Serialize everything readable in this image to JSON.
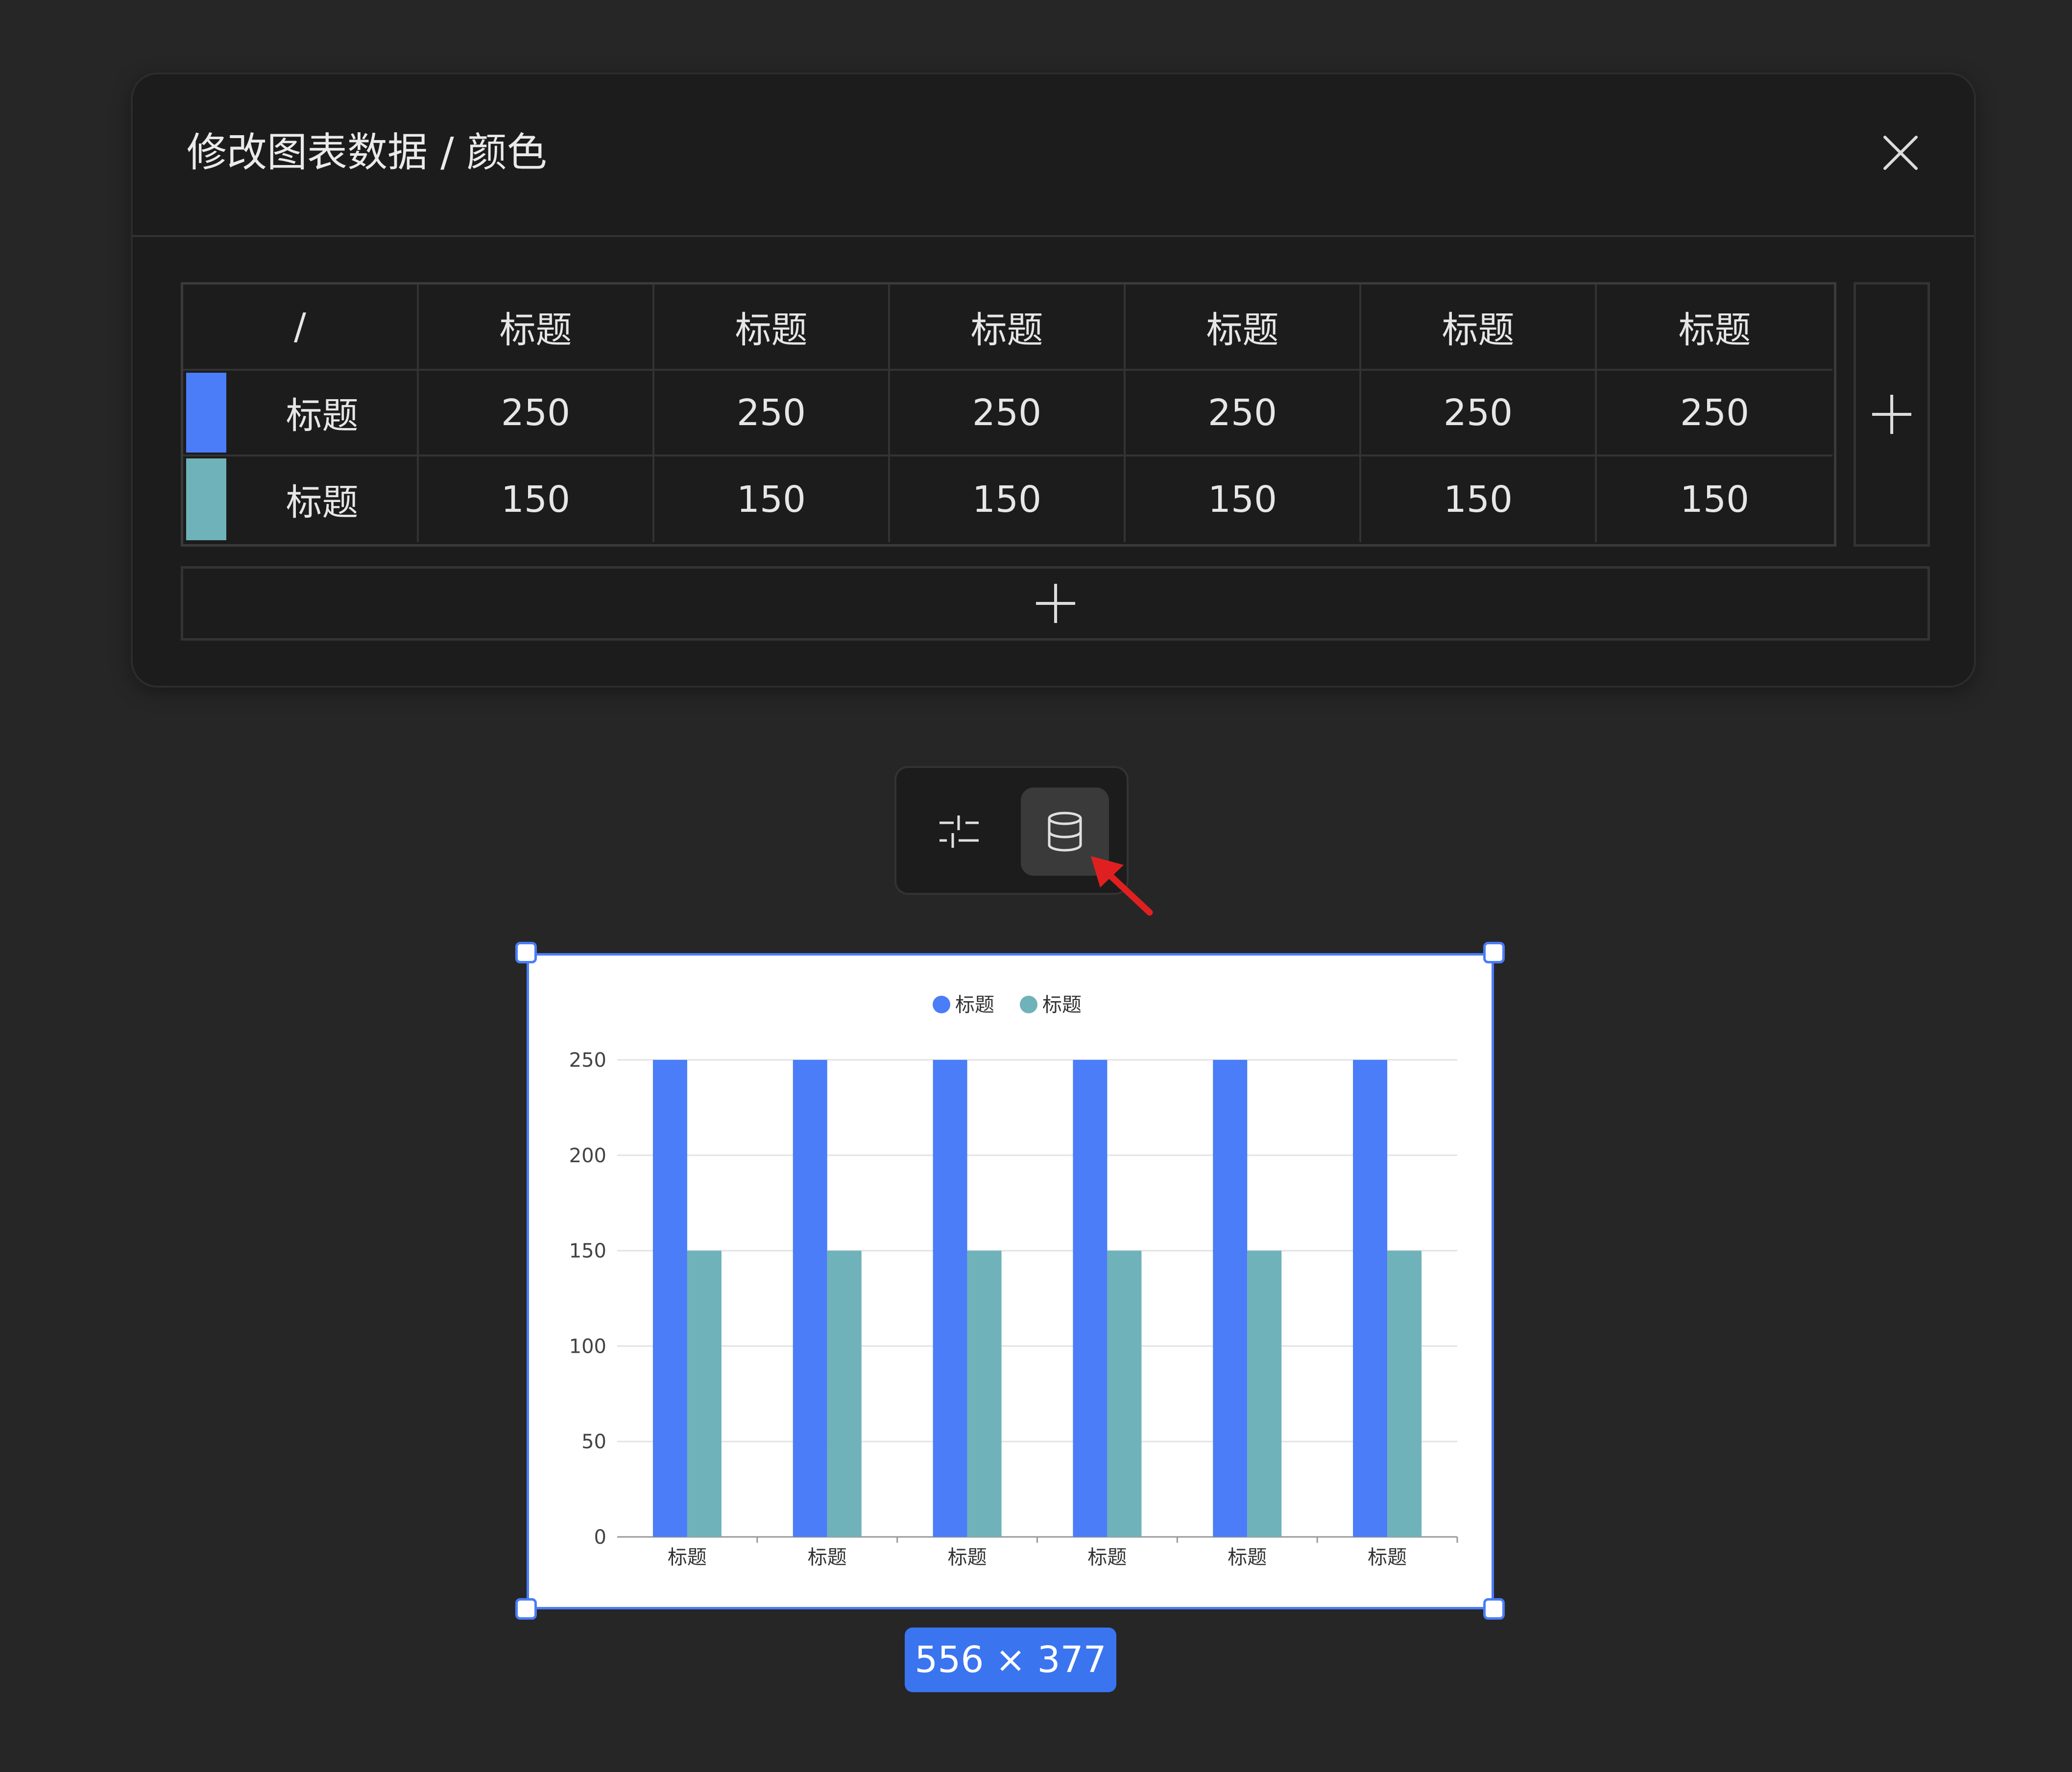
{
  "dialog": {
    "title": "修改图表数据 / 颜色",
    "corner_header": "/",
    "column_headers": [
      "标题",
      "标题",
      "标题",
      "标题",
      "标题",
      "标题"
    ],
    "rows": [
      {
        "label": "标题",
        "color": "#4a7df7",
        "values": [
          "250",
          "250",
          "250",
          "250",
          "250",
          "250"
        ]
      },
      {
        "label": "标题",
        "color": "#70b2b9",
        "values": [
          "150",
          "150",
          "150",
          "150",
          "150",
          "150"
        ]
      }
    ]
  },
  "toolbar": {
    "buttons": [
      {
        "icon": "sliders-icon",
        "active": false
      },
      {
        "icon": "database-icon",
        "active": true
      }
    ]
  },
  "size_badge": "556 × 377",
  "chart_data": {
    "type": "bar",
    "categories": [
      "标题",
      "标题",
      "标题",
      "标题",
      "标题",
      "标题"
    ],
    "series": [
      {
        "name": "标题",
        "color": "#4a7df7",
        "values": [
          250,
          250,
          250,
          250,
          250,
          250
        ]
      },
      {
        "name": "标题",
        "color": "#70b2b9",
        "values": [
          150,
          150,
          150,
          150,
          150,
          150
        ]
      }
    ],
    "ylim": [
      0,
      250
    ],
    "yticks": [
      0,
      50,
      100,
      150,
      200,
      250
    ],
    "grid": true,
    "legend": "top-center"
  }
}
